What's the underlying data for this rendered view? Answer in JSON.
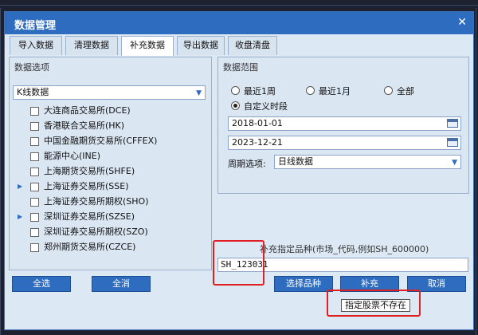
{
  "dialog": {
    "title": "数据管理",
    "close_glyph": "✕"
  },
  "tabs": [
    {
      "label": "导入数据",
      "active": false
    },
    {
      "label": "清理数据",
      "active": false
    },
    {
      "label": "补充数据",
      "active": true
    },
    {
      "label": "导出数据",
      "active": false
    },
    {
      "label": "收盘清盘",
      "active": false
    }
  ],
  "left_panel": {
    "title": "数据选项",
    "data_type": "K线数据",
    "exchanges": [
      {
        "label": "大连商品交易所(DCE)",
        "expandable": false,
        "checked": false
      },
      {
        "label": "香港联合交易所(HK)",
        "expandable": false,
        "checked": false
      },
      {
        "label": "中国金融期货交易所(CFFEX)",
        "expandable": false,
        "checked": false
      },
      {
        "label": "能源中心(INE)",
        "expandable": false,
        "checked": false
      },
      {
        "label": "上海期货交易所(SHFE)",
        "expandable": false,
        "checked": false
      },
      {
        "label": "上海证券交易所(SSE)",
        "expandable": true,
        "checked": false
      },
      {
        "label": "上海证券交易所期权(SHO)",
        "expandable": false,
        "checked": false
      },
      {
        "label": "深圳证券交易所(SZSE)",
        "expandable": true,
        "checked": false
      },
      {
        "label": "深圳证券交易所期权(SZO)",
        "expandable": false,
        "checked": false
      },
      {
        "label": "郑州期货交易所(CZCE)",
        "expandable": false,
        "checked": false
      }
    ],
    "select_all_label": "全选",
    "clear_all_label": "全消"
  },
  "right_panel": {
    "title": "数据范围",
    "ranges": [
      {
        "label": "最近1周",
        "selected": false
      },
      {
        "label": "最近1月",
        "selected": false
      },
      {
        "label": "全部",
        "selected": false
      },
      {
        "label": "自定义时段",
        "selected": true
      }
    ],
    "start_date": "2018-01-01",
    "end_date": "2023-12-21",
    "period_label": "周期选项:",
    "period_value": "日线数据"
  },
  "supplement": {
    "hint": "补充指定品种(市场_代码,例如SH_600000)",
    "code_value": "SH_123031",
    "select_button": "选择品种",
    "supplement_button": "补充",
    "cancel_button": "取消",
    "tooltip": "指定股票不存在"
  },
  "colors": {
    "titlebar": "#2e6cbf",
    "button": "#2e6cbf",
    "highlight": "#e02020"
  }
}
